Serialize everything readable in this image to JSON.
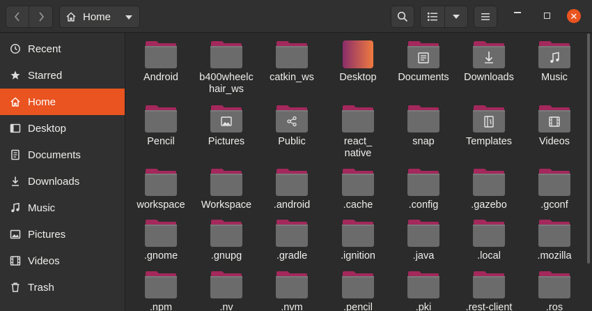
{
  "header": {
    "location_label": "Home"
  },
  "colors": {
    "accent": "#e95420",
    "folder_tab": "#a3285b",
    "folder_body": "#6b6b6b",
    "background": "#2b2b2b",
    "sidebar": "#303030"
  },
  "sidebar": {
    "items": [
      {
        "label": "Recent",
        "icon": "clock-icon"
      },
      {
        "label": "Starred",
        "icon": "star-icon"
      },
      {
        "label": "Home",
        "icon": "home-icon",
        "active": true
      },
      {
        "label": "Desktop",
        "icon": "desktop-icon"
      },
      {
        "label": "Documents",
        "icon": "document-icon"
      },
      {
        "label": "Downloads",
        "icon": "download-icon"
      },
      {
        "label": "Music",
        "icon": "music-icon"
      },
      {
        "label": "Pictures",
        "icon": "picture-icon"
      },
      {
        "label": "Videos",
        "icon": "video-icon"
      },
      {
        "label": "Trash",
        "icon": "trash-icon"
      }
    ]
  },
  "files": [
    {
      "name": "Android",
      "emblem": ""
    },
    {
      "name": "b400wheelchair_ws",
      "display": "b400wheelc\nhair_ws",
      "emblem": ""
    },
    {
      "name": "catkin_ws",
      "emblem": ""
    },
    {
      "name": "Desktop",
      "emblem": "desktop"
    },
    {
      "name": "Documents",
      "emblem": "document"
    },
    {
      "name": "Downloads",
      "emblem": "download"
    },
    {
      "name": "Music",
      "emblem": "music"
    },
    {
      "name": "Pencil",
      "emblem": ""
    },
    {
      "name": "Pictures",
      "emblem": "picture"
    },
    {
      "name": "Public",
      "emblem": "share"
    },
    {
      "name": "react_native",
      "display": "react_\nnative",
      "emblem": ""
    },
    {
      "name": "snap",
      "emblem": ""
    },
    {
      "name": "Templates",
      "emblem": "template"
    },
    {
      "name": "Videos",
      "emblem": "video"
    },
    {
      "name": "workspace",
      "emblem": ""
    },
    {
      "name": "Workspace",
      "emblem": ""
    },
    {
      "name": ".android",
      "emblem": ""
    },
    {
      "name": ".cache",
      "emblem": ""
    },
    {
      "name": ".config",
      "emblem": ""
    },
    {
      "name": ".gazebo",
      "emblem": ""
    },
    {
      "name": ".gconf",
      "emblem": ""
    },
    {
      "name": ".gnome",
      "emblem": ""
    },
    {
      "name": ".gnupg",
      "emblem": ""
    },
    {
      "name": ".gradle",
      "emblem": ""
    },
    {
      "name": ".ignition",
      "emblem": ""
    },
    {
      "name": ".java",
      "emblem": ""
    },
    {
      "name": ".local",
      "emblem": ""
    },
    {
      "name": ".mozilla",
      "emblem": ""
    },
    {
      "name": ".npm",
      "emblem": ""
    },
    {
      "name": ".nv",
      "emblem": ""
    },
    {
      "name": ".nvm",
      "emblem": ""
    },
    {
      "name": ".pencil",
      "emblem": ""
    },
    {
      "name": ".pki",
      "emblem": ""
    },
    {
      "name": ".rest-client",
      "emblem": ""
    },
    {
      "name": ".ros",
      "emblem": ""
    }
  ]
}
